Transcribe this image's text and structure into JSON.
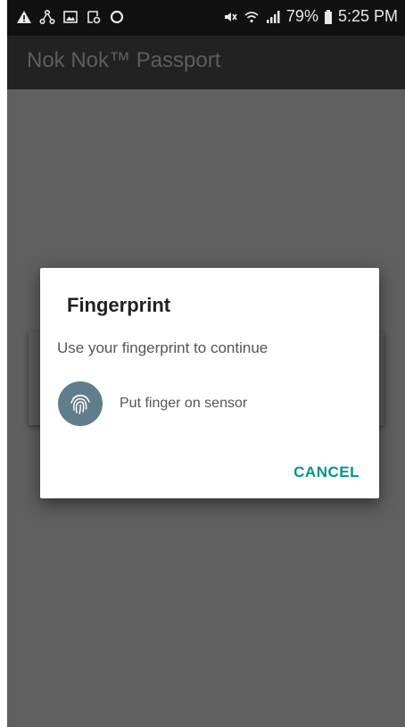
{
  "status_bar": {
    "left_icons": [
      "warning-icon",
      "share-network-icon",
      "image-icon",
      "screenshot-icon",
      "circle-icon"
    ],
    "right_icons": [
      "mute-icon",
      "wifi-icon",
      "signal-icon"
    ],
    "battery_percent": "79%",
    "time": "5:25 PM"
  },
  "app_bar": {
    "title": "Nok Nok™ Passport"
  },
  "dialog": {
    "title": "Fingerprint",
    "description": "Use your fingerprint to continue",
    "icon": "fingerprint-icon",
    "sensor_prompt": "Put finger on sensor",
    "cancel_label": "CANCEL",
    "colors": {
      "icon_background": "#607d8b",
      "accent": "#009688"
    }
  }
}
